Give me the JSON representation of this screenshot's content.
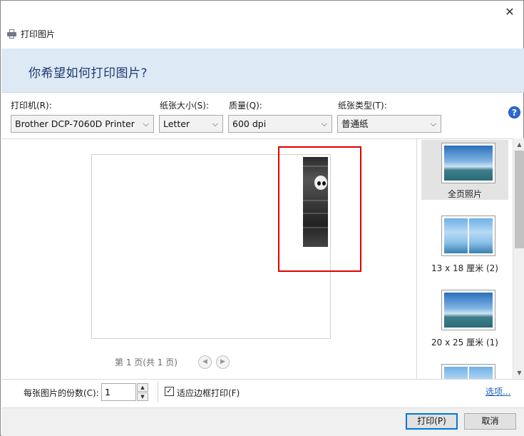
{
  "window": {
    "title": "打印图片",
    "close_glyph": "✕",
    "title_icon": "printer-icon"
  },
  "banner": {
    "heading": "你希望如何打印图片?"
  },
  "controls": {
    "printer_label": "打印机(R):",
    "printer_value": "Brother DCP-7060D Printer",
    "paper_size_label": "纸张大小(S):",
    "paper_size_value": "Letter",
    "quality_label": "质量(Q):",
    "quality_value": "600 dpi",
    "paper_type_label": "纸张类型(T):",
    "paper_type_value": "普通纸",
    "chevron_glyph": "⌵",
    "help_glyph": "?"
  },
  "preview": {
    "page_info": "第 1 页(共 1 页)",
    "prev_glyph": "◀",
    "next_glyph": "▶",
    "highlight_color": "#e00000"
  },
  "layouts": {
    "items": [
      {
        "label": "全页照片",
        "selected": true
      },
      {
        "label": "13 x 18 厘米 (2)",
        "selected": false
      },
      {
        "label": "20 x 25 厘米 (1)",
        "selected": false
      }
    ],
    "scroll_up_glyph": "▲",
    "scroll_down_glyph": "▼"
  },
  "bottom": {
    "copies_label": "每张图片的份数(C):",
    "copies_value": "1",
    "spin_up": "▲",
    "spin_down": "▼",
    "fit_label": "适应边框打印(F)",
    "fit_checked": true,
    "check_glyph": "✓",
    "options_link": "选项..."
  },
  "footer": {
    "print_button": "打印(P)",
    "cancel_button": "取消"
  }
}
